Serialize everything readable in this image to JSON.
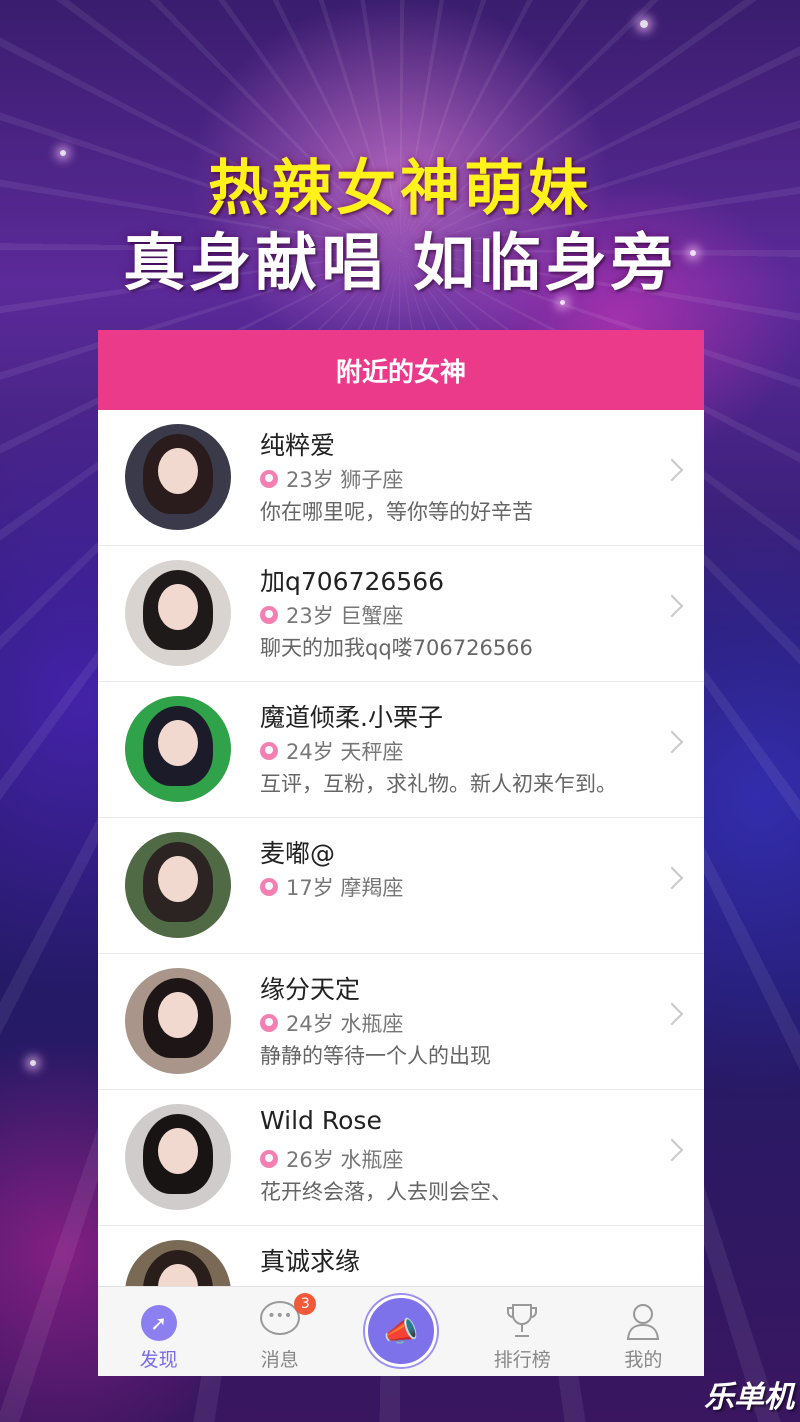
{
  "headline": {
    "line1": "热辣女神萌妹",
    "line2": "真身献唱 如临身旁"
  },
  "panel": {
    "title": "附近的女神"
  },
  "users": [
    {
      "name": "纯粹爱",
      "age": "23岁",
      "sign": "狮子座",
      "bio": "你在哪里呢，等你等的好辛苦",
      "avatar_bg": "#3a3a4a",
      "hair": "#2a1c1c"
    },
    {
      "name": "加q706726566",
      "age": "23岁",
      "sign": "巨蟹座",
      "bio": "聊天的加我qq喽706726566",
      "avatar_bg": "#d9d4d0",
      "hair": "#1f1a1a"
    },
    {
      "name": "魔道倾柔.小栗子",
      "age": "24岁",
      "sign": "天秤座",
      "bio": "互评，互粉，求礼物。新人初来乍到。",
      "avatar_bg": "#2fa24a",
      "hair": "#1b1b2a"
    },
    {
      "name": "麦嘟@",
      "age": "17岁",
      "sign": "摩羯座",
      "bio": "",
      "avatar_bg": "#4f6a44",
      "hair": "#2b2422"
    },
    {
      "name": "缘分天定",
      "age": "24岁",
      "sign": "水瓶座",
      "bio": "静静的等待一个人的出现",
      "avatar_bg": "#a9958a",
      "hair": "#1e1616"
    },
    {
      "name": "Wild Rose",
      "age": "26岁",
      "sign": "水瓶座",
      "bio": "花开终会落，人去则会空、",
      "avatar_bg": "#d0cccc",
      "hair": "#191414"
    },
    {
      "name": "真诚求缘",
      "age": "",
      "sign": "",
      "bio": "",
      "avatar_bg": "#7a6a55",
      "hair": "#2a1e1a"
    }
  ],
  "tabs": {
    "discover": "发现",
    "messages": "消息",
    "messages_badge": "3",
    "ranking": "排行榜",
    "profile": "我的"
  },
  "watermark": "乐单机",
  "colors": {
    "accent_pink": "#ec3a8a",
    "tab_active": "#7a6ae8",
    "headline_yellow": "#fff21a"
  }
}
